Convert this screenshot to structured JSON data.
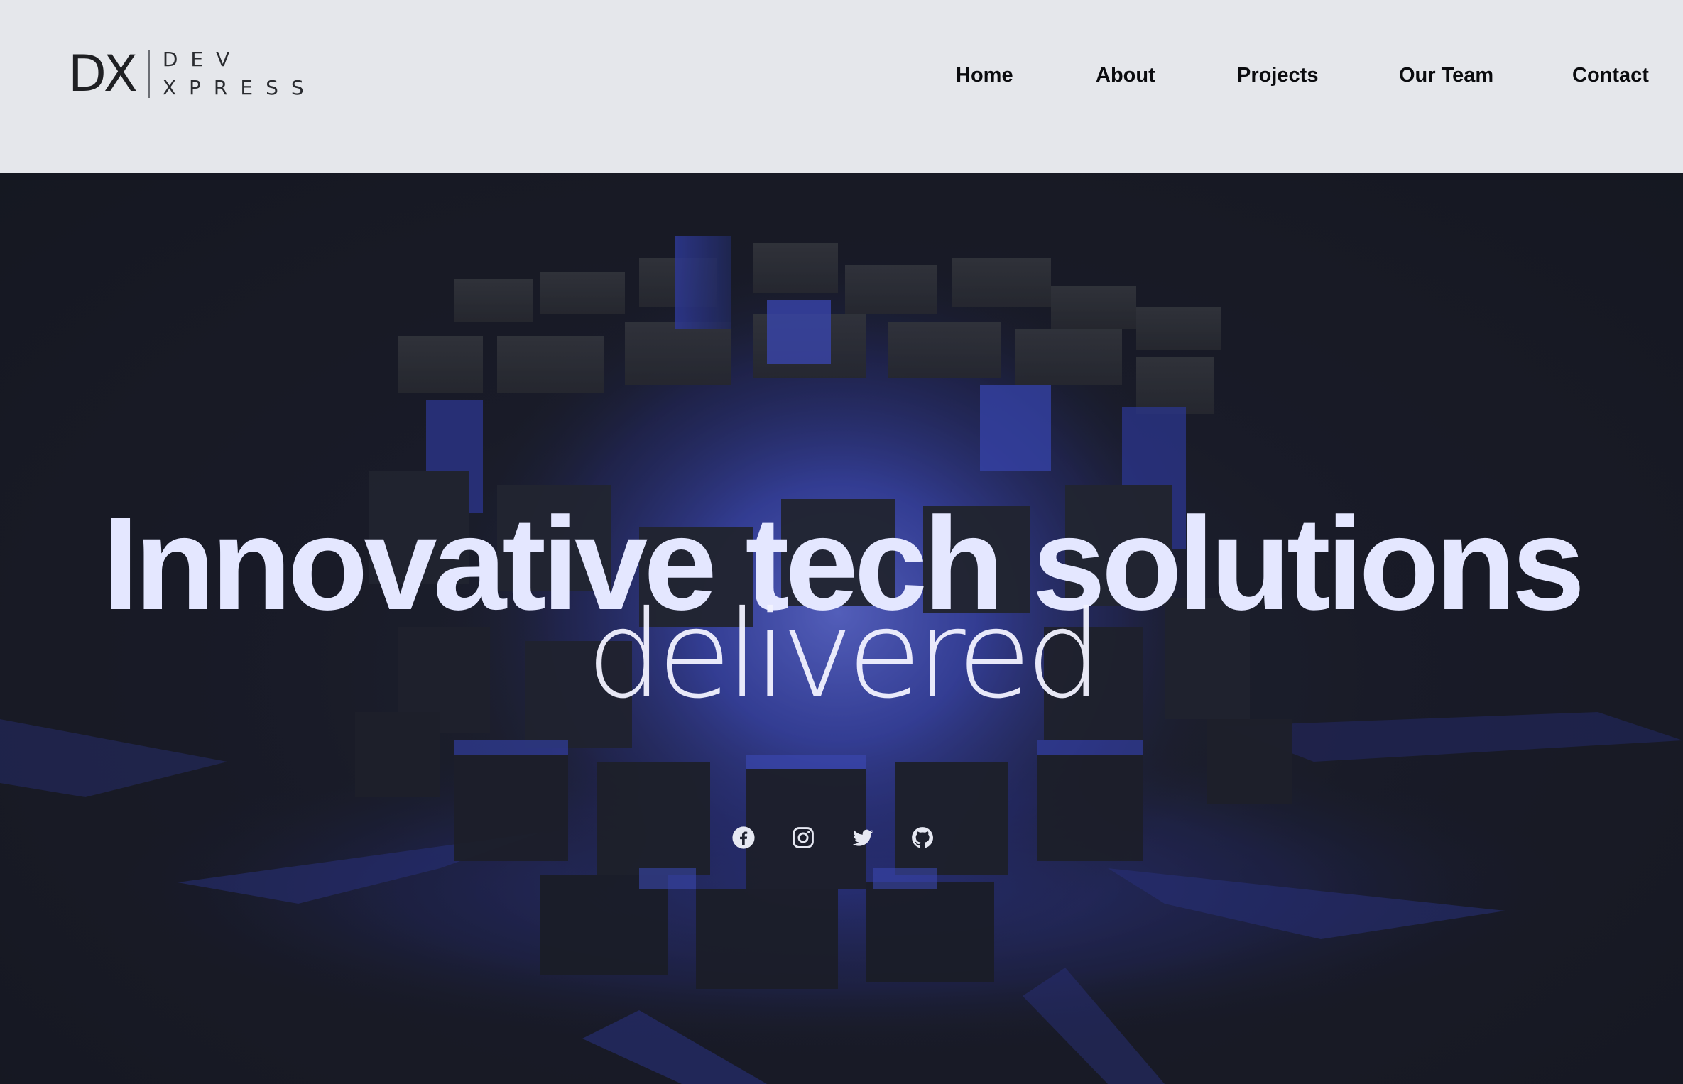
{
  "brand": {
    "mark": "DX",
    "line1": "DEV",
    "line2": "XPRESS"
  },
  "nav": {
    "items": [
      {
        "label": "Home"
      },
      {
        "label": "About"
      },
      {
        "label": "Projects"
      },
      {
        "label": "Our Team"
      },
      {
        "label": "Contact"
      }
    ]
  },
  "hero": {
    "headline": "Innovative tech solutions",
    "subheadline": "delivered"
  },
  "social": {
    "icons": [
      "facebook-icon",
      "instagram-icon",
      "twitter-icon",
      "github-icon"
    ]
  },
  "colors": {
    "header_bg": "#e5e7eb",
    "hero_bg": "#1a1d27",
    "accent_blue": "#3b4bd8",
    "headline_text": "#e4e7ff"
  }
}
